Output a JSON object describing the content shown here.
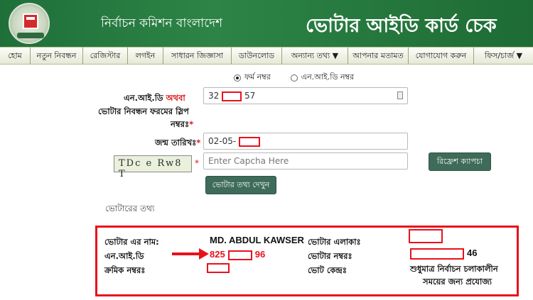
{
  "header": {
    "left_title": "নির্বাচন কমিশন বাংলাদেশ",
    "right_title": "ভোটার আইডি কার্ড চেক"
  },
  "nav": {
    "items": [
      "হোম",
      "নতুন নিবন্ধন",
      "রেজিস্টার",
      "লগইন",
      "সাধারন জিজ্ঞাসা",
      "ডাউনলোড",
      "অন্যান্য তথ্য ▼",
      "আপনার মতামত",
      "যোগাযোগ করুন",
      "ফিস/চার্জ ▼"
    ]
  },
  "form": {
    "radio_form_no": "ফর্ম নম্বর",
    "radio_nid_no": "এন.আই.ডি নম্বর",
    "label_nid": "এন.আই.ডি",
    "label_or": "অথবা",
    "label_slip": "ভোটার নিবন্ধন ফরমের স্লিপ",
    "label_slip2": "নম্বরঃ",
    "nid_prefix": "32",
    "nid_suffix": "57",
    "label_dob": "জন্ম তারিখঃ",
    "dob_prefix": "02-05-",
    "captcha_text": "TDc e Rw8 T",
    "captcha_placeholder": "Enter Capcha Here",
    "refresh_button": "রিফ্রেশ ক্যাপচা",
    "submit_button": "ভোটার তথ্য দেখুন"
  },
  "voter_info": {
    "section_title": "ভোটারের তথ্য",
    "name_label": "ভোটার এর নাম:",
    "name_value": "MD. ABDUL KAWSER",
    "area_label": "ভোটার এলাকাঃ",
    "nid_label": "এন.আই.ডি",
    "nid_prefix": "825",
    "nid_suffix": "96",
    "voter_no_label": "ভোটার নম্বরঃ",
    "voter_no_suffix": "46",
    "serial_label": "ক্রমিক নম্বরঃ",
    "center_label": "ভোট কেন্দ্রঃ",
    "center_note_1": "শুধুমাত্র নির্বাচন চলাকালীন",
    "center_note_2": "সময়ের জন্য প্রযোজ্য"
  },
  "colors": {
    "header_green": "#2d8446",
    "highlight_red": "#e8121c",
    "button_green": "#3f6b5a"
  }
}
